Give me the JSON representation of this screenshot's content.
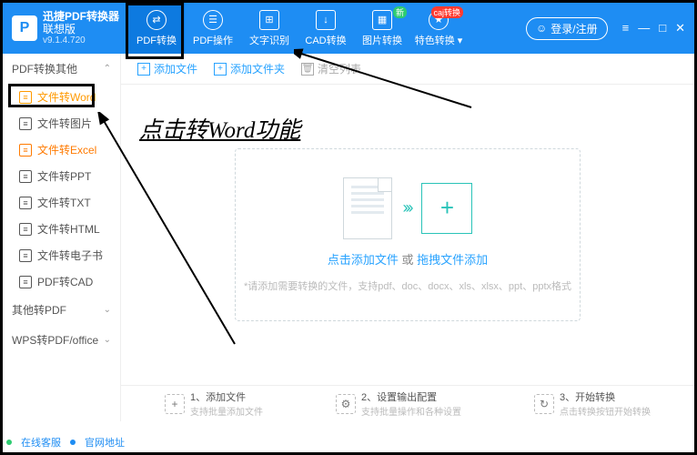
{
  "brand": {
    "logo": "P",
    "title": "迅捷PDF转换器",
    "subtitle": "联想版",
    "version": "v9.1.4.720"
  },
  "tabs": [
    {
      "label": "PDF转换",
      "icon": "⇄",
      "active": true
    },
    {
      "label": "PDF操作",
      "icon": "☰"
    },
    {
      "label": "文字识别",
      "icon": "⊞"
    },
    {
      "label": "CAD转换",
      "icon": "↓"
    },
    {
      "label": "图片转换",
      "icon": "▦",
      "badge": "新",
      "badge_color": "green"
    },
    {
      "label": "特色转换",
      "icon": "★",
      "has_chev": true,
      "badge": "caj转换",
      "badge_color": "red"
    }
  ],
  "login": {
    "label": "登录/注册"
  },
  "sidebar": {
    "group0": {
      "label": "PDF转换其他",
      "open": true
    },
    "items": [
      {
        "label": "文件转Word",
        "active": true
      },
      {
        "label": "文件转图片"
      },
      {
        "label": "文件转Excel",
        "orange": true
      },
      {
        "label": "文件转PPT"
      },
      {
        "label": "文件转TXT"
      },
      {
        "label": "文件转HTML"
      },
      {
        "label": "文件转电子书"
      },
      {
        "label": "PDF转CAD"
      }
    ],
    "group1": {
      "label": "其他转PDF"
    },
    "group2": {
      "label": "WPS转PDF/office"
    }
  },
  "toolbar": {
    "add_file": "添加文件",
    "add_folder": "添加文件夹",
    "clear_list": "清空列表"
  },
  "dropzone": {
    "click_text": "点击添加文件",
    "or": "或",
    "drag_text": "拖拽文件添加",
    "hint": "*请添加需要转换的文件，支持pdf、doc、docx、xls、xlsx、ppt、pptx格式"
  },
  "steps": {
    "s1": {
      "num": "1、",
      "title": "添加文件",
      "sub": "支持批量添加文件"
    },
    "s2": {
      "num": "2、",
      "title": "设置输出配置",
      "sub": "支持批量操作和各种设置"
    },
    "s3": {
      "num": "3、",
      "title": "开始转换",
      "sub": "点击转换按钮开始转换"
    }
  },
  "bottombar": {
    "a": "在线客服",
    "b": "官网地址"
  },
  "annotation": {
    "text": "点击转Word功能"
  }
}
